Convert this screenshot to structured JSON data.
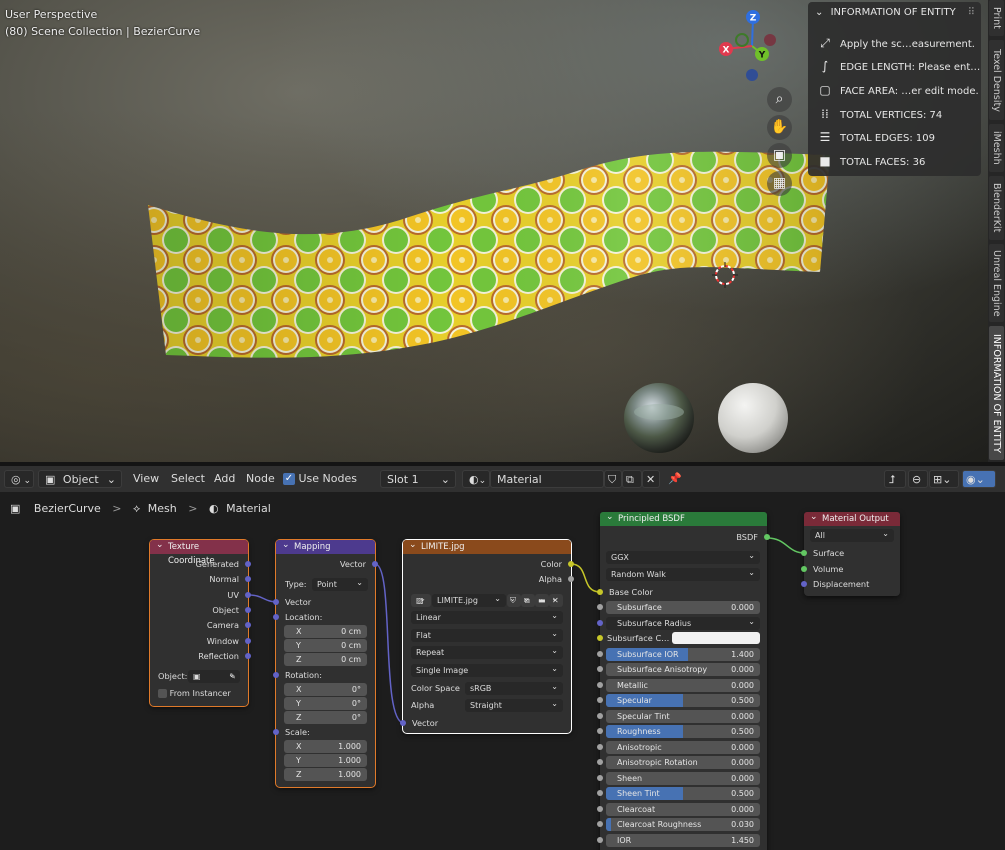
{
  "viewport": {
    "perspective": "User Perspective",
    "collection": "(80) Scene Collection | BezierCurve"
  },
  "gizmo": {
    "z": "Z",
    "y": "Y",
    "x": "X"
  },
  "nav_icons": [
    "zoom-icon",
    "hand-icon",
    "camera-icon",
    "grid-icon"
  ],
  "info_panel": {
    "title": "INFORMATION OF ENTITY",
    "rows": [
      {
        "icon": "ruler-icon",
        "text": "Apply the sc…easurement."
      },
      {
        "icon": "edge-icon",
        "text": "EDGE LENGTH: Please ent…"
      },
      {
        "icon": "face-icon",
        "text": "FACE AREA: …er edit mode."
      },
      {
        "icon": "vertices-icon",
        "text": "TOTAL VERTICES: 74"
      },
      {
        "icon": "edges-icon",
        "text": "TOTAL EDGES: 109"
      },
      {
        "icon": "faces-icon",
        "text": "TOTAL FACES: 36"
      }
    ]
  },
  "side_tabs": [
    "Print",
    "Texel Density",
    "iMeshh",
    "BlenderKit",
    "Unreal Engine",
    "INFORMATION OF ENTITY"
  ],
  "node_header": {
    "editor_icon": "node-editor-icon",
    "mode": "Object",
    "menus": [
      "View",
      "Select",
      "Add",
      "Node"
    ],
    "use_nodes_label": "Use Nodes",
    "use_nodes": true,
    "slot": "Slot 1",
    "material": "Material"
  },
  "breadcrumb": {
    "object": "BezierCurve",
    "mesh": "Mesh",
    "material": "Material",
    "sep": ">"
  },
  "nodes": {
    "texcoord": {
      "title": "Texture Coordinate",
      "outputs": [
        "Generated",
        "Normal",
        "UV",
        "Object",
        "Camera",
        "Window",
        "Reflection"
      ],
      "object_label": "Object:",
      "from_instancer": "From Instancer"
    },
    "mapping": {
      "title": "Mapping",
      "output": "Vector",
      "type_label": "Type:",
      "type_value": "Point",
      "vector_label": "Vector",
      "location_label": "Location:",
      "location": [
        {
          "k": "X",
          "v": "0 cm"
        },
        {
          "k": "Y",
          "v": "0 cm"
        },
        {
          "k": "Z",
          "v": "0 cm"
        }
      ],
      "rotation_label": "Rotation:",
      "rotation": [
        {
          "k": "X",
          "v": "0°"
        },
        {
          "k": "Y",
          "v": "0°"
        },
        {
          "k": "Z",
          "v": "0°"
        }
      ],
      "scale_label": "Scale:",
      "scale": [
        {
          "k": "X",
          "v": "1.000"
        },
        {
          "k": "Y",
          "v": "1.000"
        },
        {
          "k": "Z",
          "v": "1.000"
        }
      ]
    },
    "image": {
      "title": "LIMITE.jpg",
      "outputs": [
        "Color",
        "Alpha"
      ],
      "image_name": "LIMITE.jpg",
      "interpolation": "Linear",
      "projection": "Flat",
      "extension": "Repeat",
      "source": "Single Image",
      "colorspace_label": "Color Space",
      "colorspace": "sRGB",
      "alpha_label": "Alpha",
      "alpha": "Straight",
      "input": "Vector"
    },
    "bsdf": {
      "title": "Principled BSDF",
      "output": "BSDF",
      "distribution": "GGX",
      "subsurface_method": "Random Walk",
      "base_color": "Base Color",
      "fields": [
        {
          "name": "Subsurface",
          "value": "0.000",
          "fill": 0
        },
        {
          "name": "Subsurface Radius",
          "dropdown": true
        },
        {
          "name": "Subsurface C…",
          "color": true
        },
        {
          "name": "Subsurface IOR",
          "value": "1.400",
          "fill": 0.53
        },
        {
          "name": "Subsurface Anisotropy",
          "value": "0.000",
          "fill": 0
        },
        {
          "name": "Metallic",
          "value": "0.000",
          "fill": 0
        },
        {
          "name": "Specular",
          "value": "0.500",
          "fill": 0.5
        },
        {
          "name": "Specular Tint",
          "value": "0.000",
          "fill": 0
        },
        {
          "name": "Roughness",
          "value": "0.500",
          "fill": 0.5
        },
        {
          "name": "Anisotropic",
          "value": "0.000",
          "fill": 0
        },
        {
          "name": "Anisotropic Rotation",
          "value": "0.000",
          "fill": 0
        },
        {
          "name": "Sheen",
          "value": "0.000",
          "fill": 0
        },
        {
          "name": "Sheen Tint",
          "value": "0.500",
          "fill": 0.5
        },
        {
          "name": "Clearcoat",
          "value": "0.000",
          "fill": 0
        },
        {
          "name": "Clearcoat Roughness",
          "value": "0.030",
          "fill": 0.03
        },
        {
          "name": "IOR",
          "value": "1.450",
          "fill": 0
        }
      ]
    },
    "output": {
      "title": "Material Output",
      "target": "All",
      "inputs": [
        "Surface",
        "Volume",
        "Displacement"
      ]
    }
  }
}
